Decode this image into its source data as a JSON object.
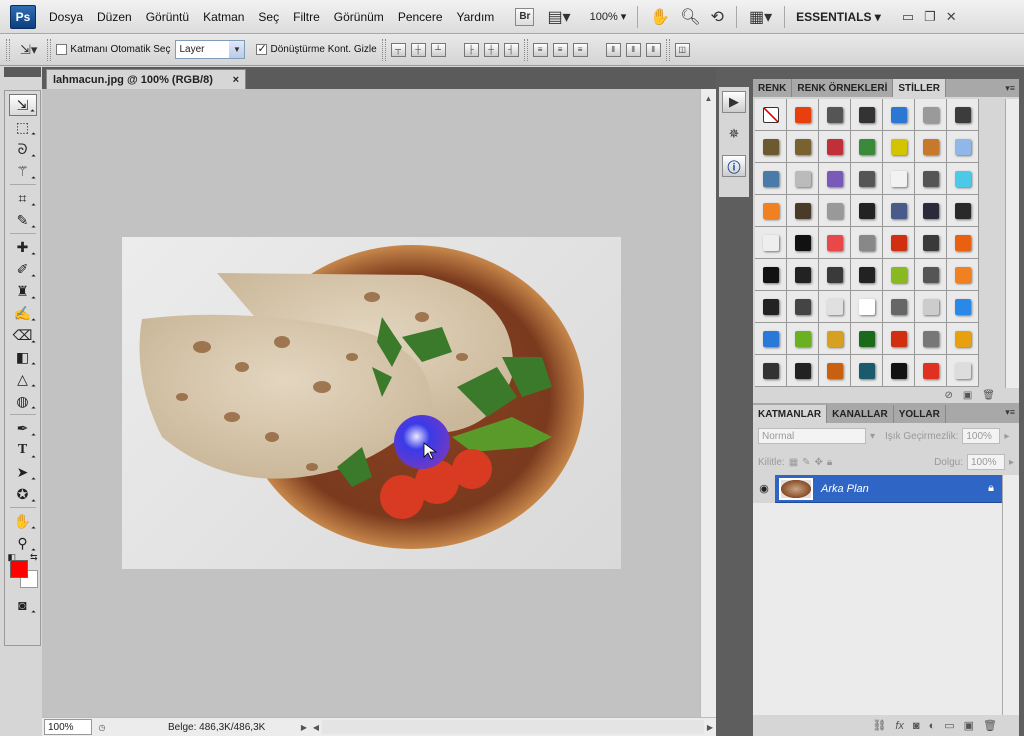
{
  "menubar": {
    "logo": "Ps",
    "items": [
      "Dosya",
      "Düzen",
      "Görüntü",
      "Katman",
      "Seç",
      "Filtre",
      "Görünüm",
      "Pencere",
      "Yardım"
    ],
    "bridge": "Br",
    "zoom": "100%",
    "workspace": "ESSENTIALS"
  },
  "options": {
    "auto_select_label": "Katmanı Otomatik Seç",
    "auto_select_target": "Layer",
    "show_transform_label": "Dönüştürme Kont. Gizle"
  },
  "document": {
    "tab_title": "lahmacun.jpg @ 100% (RGB/8)",
    "close": "×"
  },
  "status": {
    "zoom": "100%",
    "doc_info": "Belge: 486,3K/486,3K"
  },
  "styles_panel": {
    "tabs": [
      "RENK",
      "RENK ÖRNEKLERİ",
      "STİLLER"
    ]
  },
  "layers_panel": {
    "tabs": [
      "KATMANLAR",
      "KANALLAR",
      "YOLLAR"
    ],
    "blend_mode": "Normal",
    "opacity_label": "Işık Geçirmezlik:",
    "opacity_value": "100%",
    "lock_label": "Kilitle:",
    "fill_label": "Dolgu:",
    "fill_value": "100%",
    "layer_name": "Arka Plan"
  },
  "colors": {
    "foreground": "#ff0000",
    "background": "#ffffff",
    "selected_layer": "#2f66c6"
  },
  "style_swatches": [
    "#ffffff",
    "#e8400c",
    "#555555",
    "#333333",
    "#2b78d4",
    "#9a9a9a",
    "#3c3c3c",
    "#6b5a2e",
    "#7a6230",
    "#c0303a",
    "#3a8a3a",
    "#d4c400",
    "#c8782a",
    "#8fb8e8",
    "#4a7aa8",
    "#bbbbbb",
    "#7a5ab8",
    "#555555",
    "#f2f2f2",
    "#555555",
    "#4cc8e8",
    "#f08020",
    "#4a3a2a",
    "#999999",
    "#222222",
    "#4a5a8a",
    "#2a2a3a",
    "#2a2a2a",
    "#eeeeee",
    "#111111",
    "#e84848",
    "#888888",
    "#d03010",
    "#3a3a3a",
    "#e86010",
    "#111111",
    "#222222",
    "#3a3a3a",
    "#222222",
    "#8ab820",
    "#555555",
    "#f08020",
    "#222222",
    "#444444",
    "#e0e0e0",
    "#ffffff",
    "#666666",
    "#cccccc",
    "#2a88e8",
    "#2a78d8",
    "#6ab020",
    "#d8a020",
    "#1a6a1a",
    "#d03010",
    "#777777",
    "#e8a010",
    "#333333",
    "#222222",
    "#c86010",
    "#1a5a6a",
    "#111111",
    "#e03020",
    "#dddddd"
  ]
}
